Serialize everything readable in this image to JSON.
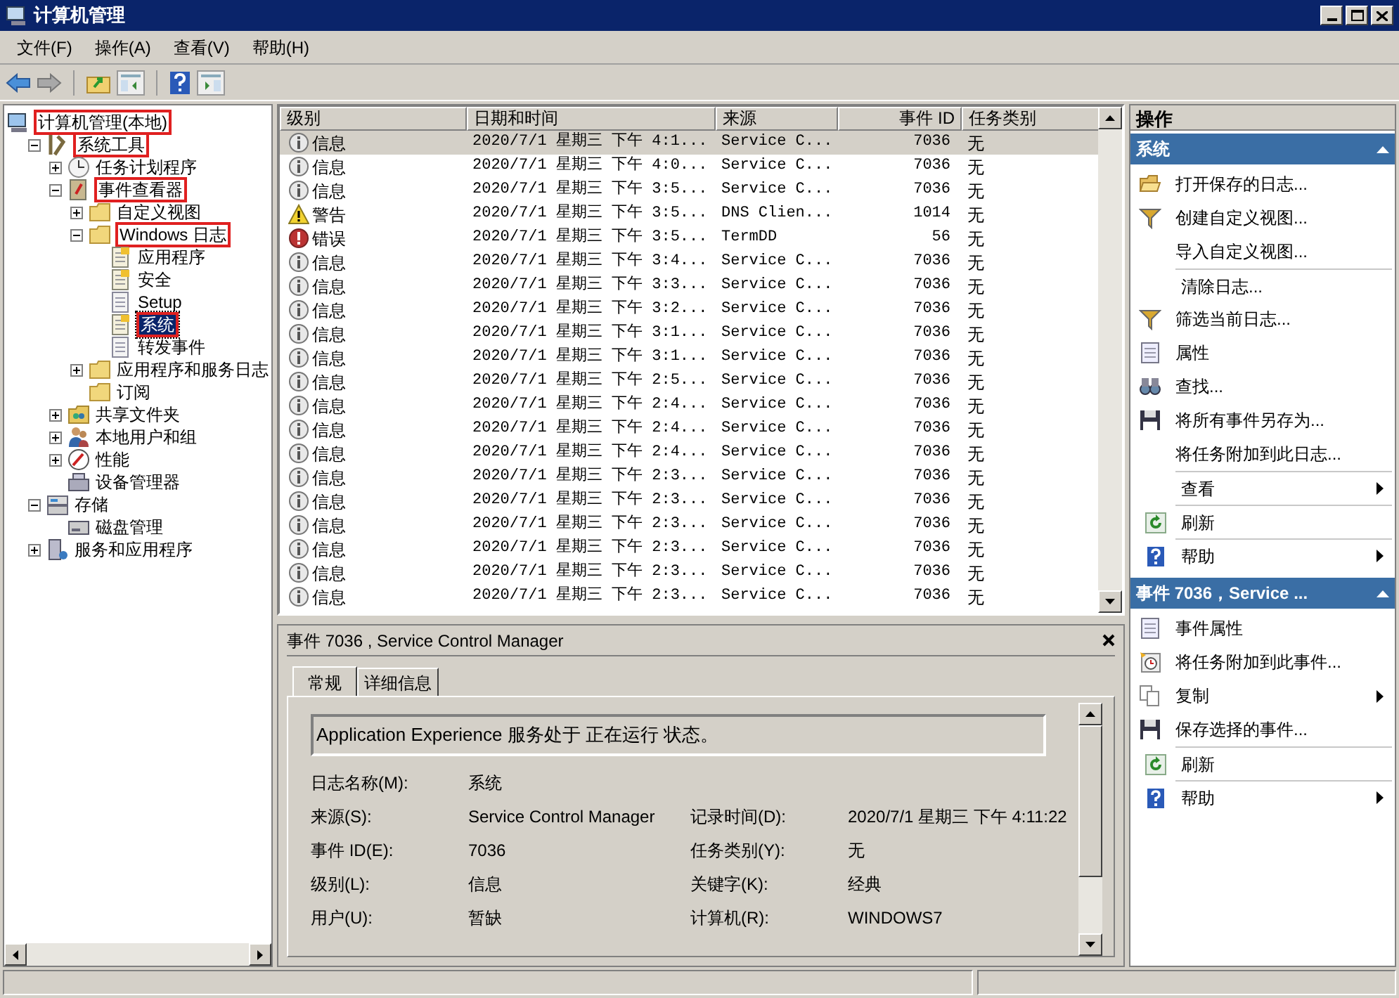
{
  "window": {
    "title": "计算机管理"
  },
  "menu": [
    "文件(F)",
    "操作(A)",
    "查看(V)",
    "帮助(H)"
  ],
  "tree": [
    {
      "label": "计算机管理(本地)",
      "kind": "computer",
      "highlighted": true,
      "selected": false,
      "children": [
        {
          "label": "系统工具",
          "kind": "tools",
          "expanded": true,
          "highlighted": true,
          "selected": false,
          "children": [
            {
              "label": "任务计划程序",
              "kind": "clock",
              "expanded": false,
              "highlighted": false,
              "selected": false
            },
            {
              "label": "事件查看器",
              "kind": "viewer",
              "expanded": true,
              "highlighted": true,
              "selected": false,
              "children": [
                {
                  "label": "自定义视图",
                  "kind": "folder",
                  "expanded": false,
                  "highlighted": false,
                  "selected": false
                },
                {
                  "label": "Windows 日志",
                  "kind": "folder",
                  "expanded": true,
                  "highlighted": true,
                  "selected": false,
                  "children": [
                    {
                      "label": "应用程序",
                      "kind": "log",
                      "highlighted": false,
                      "selected": false
                    },
                    {
                      "label": "安全",
                      "kind": "log",
                      "highlighted": false,
                      "selected": false
                    },
                    {
                      "label": "Setup",
                      "kind": "plainlog",
                      "highlighted": false,
                      "selected": false
                    },
                    {
                      "label": "系统",
                      "kind": "log",
                      "highlighted": true,
                      "selected": true
                    },
                    {
                      "label": "转发事件",
                      "kind": "plainlog",
                      "highlighted": false,
                      "selected": false
                    }
                  ]
                },
                {
                  "label": "应用程序和服务日志",
                  "kind": "folder",
                  "expanded": false,
                  "highlighted": false,
                  "selected": false
                },
                {
                  "label": "订阅",
                  "kind": "folder",
                  "highlighted": false,
                  "selected": false
                }
              ]
            },
            {
              "label": "共享文件夹",
              "kind": "share",
              "expanded": false,
              "highlighted": false,
              "selected": false
            },
            {
              "label": "本地用户和组",
              "kind": "users",
              "expanded": false,
              "highlighted": false,
              "selected": false
            },
            {
              "label": "性能",
              "kind": "gauge",
              "expanded": false,
              "highlighted": false,
              "selected": false
            },
            {
              "label": "设备管理器",
              "kind": "device",
              "highlighted": false,
              "selected": false
            }
          ]
        },
        {
          "label": "存储",
          "kind": "storage",
          "expanded": true,
          "highlighted": false,
          "selected": false,
          "children": [
            {
              "label": "磁盘管理",
              "kind": "disk",
              "highlighted": false,
              "selected": false
            }
          ]
        },
        {
          "label": "服务和应用程序",
          "kind": "services",
          "expanded": false,
          "highlighted": false,
          "selected": false
        }
      ]
    }
  ],
  "table": {
    "columns": [
      "级别",
      "日期和时间",
      "来源",
      "事件 ID",
      "任务类别"
    ],
    "rows": [
      {
        "kind": "info",
        "level_text": "信息",
        "date": "2020/7/1 星期三 下午 4:1...",
        "source": "Service C...",
        "id": "7036",
        "category": "无",
        "selected": true
      },
      {
        "kind": "info",
        "level_text": "信息",
        "date": "2020/7/1 星期三 下午 4:0...",
        "source": "Service C...",
        "id": "7036",
        "category": "无",
        "selected": false
      },
      {
        "kind": "info",
        "level_text": "信息",
        "date": "2020/7/1 星期三 下午 3:5...",
        "source": "Service C...",
        "id": "7036",
        "category": "无",
        "selected": false
      },
      {
        "kind": "warning",
        "level_text": "警告",
        "date": "2020/7/1 星期三 下午 3:5...",
        "source": "DNS Clien...",
        "id": "1014",
        "category": "无",
        "selected": false
      },
      {
        "kind": "error",
        "level_text": "错误",
        "date": "2020/7/1 星期三 下午 3:5...",
        "source": "TermDD",
        "id": "56",
        "category": "无",
        "selected": false
      },
      {
        "kind": "info",
        "level_text": "信息",
        "date": "2020/7/1 星期三 下午 3:4...",
        "source": "Service C...",
        "id": "7036",
        "category": "无",
        "selected": false
      },
      {
        "kind": "info",
        "level_text": "信息",
        "date": "2020/7/1 星期三 下午 3:3...",
        "source": "Service C...",
        "id": "7036",
        "category": "无",
        "selected": false
      },
      {
        "kind": "info",
        "level_text": "信息",
        "date": "2020/7/1 星期三 下午 3:2...",
        "source": "Service C...",
        "id": "7036",
        "category": "无",
        "selected": false
      },
      {
        "kind": "info",
        "level_text": "信息",
        "date": "2020/7/1 星期三 下午 3:1...",
        "source": "Service C...",
        "id": "7036",
        "category": "无",
        "selected": false
      },
      {
        "kind": "info",
        "level_text": "信息",
        "date": "2020/7/1 星期三 下午 3:1...",
        "source": "Service C...",
        "id": "7036",
        "category": "无",
        "selected": false
      },
      {
        "kind": "info",
        "level_text": "信息",
        "date": "2020/7/1 星期三 下午 2:5...",
        "source": "Service C...",
        "id": "7036",
        "category": "无",
        "selected": false
      },
      {
        "kind": "info",
        "level_text": "信息",
        "date": "2020/7/1 星期三 下午 2:4...",
        "source": "Service C...",
        "id": "7036",
        "category": "无",
        "selected": false
      },
      {
        "kind": "info",
        "level_text": "信息",
        "date": "2020/7/1 星期三 下午 2:4...",
        "source": "Service C...",
        "id": "7036",
        "category": "无",
        "selected": false
      },
      {
        "kind": "info",
        "level_text": "信息",
        "date": "2020/7/1 星期三 下午 2:4...",
        "source": "Service C...",
        "id": "7036",
        "category": "无",
        "selected": false
      },
      {
        "kind": "info",
        "level_text": "信息",
        "date": "2020/7/1 星期三 下午 2:3...",
        "source": "Service C...",
        "id": "7036",
        "category": "无",
        "selected": false
      },
      {
        "kind": "info",
        "level_text": "信息",
        "date": "2020/7/1 星期三 下午 2:3...",
        "source": "Service C...",
        "id": "7036",
        "category": "无",
        "selected": false
      },
      {
        "kind": "info",
        "level_text": "信息",
        "date": "2020/7/1 星期三 下午 2:3...",
        "source": "Service C...",
        "id": "7036",
        "category": "无",
        "selected": false
      },
      {
        "kind": "info",
        "level_text": "信息",
        "date": "2020/7/1 星期三 下午 2:3...",
        "source": "Service C...",
        "id": "7036",
        "category": "无",
        "selected": false
      },
      {
        "kind": "info",
        "level_text": "信息",
        "date": "2020/7/1 星期三 下午 2:3...",
        "source": "Service C...",
        "id": "7036",
        "category": "无",
        "selected": false
      },
      {
        "kind": "info",
        "level_text": "信息",
        "date": "2020/7/1 星期三 下午 2:3...",
        "source": "Service C...",
        "id": "7036",
        "category": "无",
        "selected": false
      }
    ]
  },
  "detail": {
    "title": "事件 7036 , Service Control Manager",
    "tabs": [
      {
        "label": "常规",
        "selected": true
      },
      {
        "label": "详细信息",
        "selected": false
      }
    ],
    "message": "Application Experience 服务处于 正在运行 状态。",
    "fields_left": [
      {
        "label": "日志名称(M):",
        "value": "系统"
      },
      {
        "label": "来源(S):",
        "value": "Service Control Manager"
      },
      {
        "label": "事件 ID(E):",
        "value": "7036"
      },
      {
        "label": "级别(L):",
        "value": "信息"
      },
      {
        "label": "用户(U):",
        "value": "暂缺"
      }
    ],
    "fields_right": [
      {
        "label": "记录时间(D):",
        "value": "2020/7/1 星期三 下午 4:11:22"
      },
      {
        "label": "任务类别(Y):",
        "value": "无"
      },
      {
        "label": "关键字(K):",
        "value": "经典"
      },
      {
        "label": "计算机(R):",
        "value": "WINDOWS7"
      }
    ]
  },
  "actions": {
    "title": "操作",
    "sections": [
      {
        "title": "系统",
        "items": [
          {
            "label": "打开保存的日志...",
            "kind": "open",
            "submenu": false,
            "divider_above": false
          },
          {
            "label": "创建自定义视图...",
            "kind": "funnel",
            "submenu": false,
            "divider_above": false
          },
          {
            "label": "导入自定义视图...",
            "kind": "none",
            "submenu": false,
            "divider_above": false
          },
          {
            "label": "清除日志...",
            "kind": "none",
            "submenu": false,
            "divider_above": true
          },
          {
            "label": "筛选当前日志...",
            "kind": "funnel",
            "submenu": false,
            "divider_above": false
          },
          {
            "label": "属性",
            "kind": "props",
            "submenu": false,
            "divider_above": false
          },
          {
            "label": "查找...",
            "kind": "find",
            "submenu": false,
            "divider_above": false
          },
          {
            "label": "将所有事件另存为...",
            "kind": "save",
            "submenu": false,
            "divider_above": false
          },
          {
            "label": "将任务附加到此日志...",
            "kind": "none",
            "submenu": false,
            "divider_above": false
          },
          {
            "label": "查看",
            "kind": "none",
            "submenu": true,
            "divider_above": true
          },
          {
            "label": "刷新",
            "kind": "refresh",
            "submenu": false,
            "divider_above": true
          },
          {
            "label": "帮助",
            "kind": "help",
            "submenu": true,
            "divider_above": true
          }
        ]
      },
      {
        "title": "事件 7036，Service ...",
        "items": [
          {
            "label": "事件属性",
            "kind": "props",
            "submenu": false,
            "divider_above": false
          },
          {
            "label": "将任务附加到此事件...",
            "kind": "task",
            "submenu": false,
            "divider_above": false
          },
          {
            "label": "复制",
            "kind": "copy",
            "submenu": true,
            "divider_above": false
          },
          {
            "label": "保存选择的事件...",
            "kind": "save",
            "submenu": false,
            "divider_above": false
          },
          {
            "label": "刷新",
            "kind": "refresh",
            "submenu": false,
            "divider_above": true
          },
          {
            "label": "帮助",
            "kind": "help",
            "submenu": true,
            "divider_above": true
          }
        ]
      }
    ]
  }
}
